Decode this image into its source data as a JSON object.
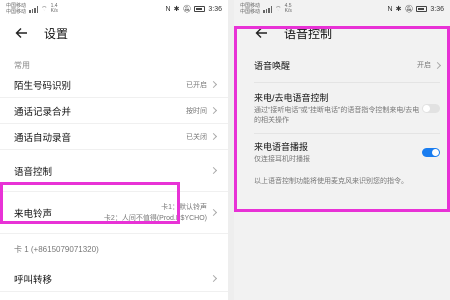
{
  "left": {
    "status": {
      "carrier1": "中国移动",
      "carrier2": "中国移动",
      "speed": "1.4",
      "speed_unit": "K/s",
      "time": "3:36",
      "battery": "",
      "nfc": "N",
      "bt": "✱"
    },
    "title": "设置",
    "section_label": "常用",
    "items": [
      {
        "label": "陌生号码识别",
        "value": "已开启"
      },
      {
        "label": "通话记录合并",
        "value": "按时间"
      },
      {
        "label": "通话自动录音",
        "value": "已关闭"
      },
      {
        "label": "语音控制",
        "value": ""
      }
    ],
    "ringtone": {
      "label": "来电铃声",
      "sim1": "卡1：默认铃声",
      "sim2": "卡2：人间不值得(Prod.P$YCHO)"
    },
    "sim_label": "卡 1 (+8615079071320)",
    "partial_item": "呼叫转移"
  },
  "right": {
    "status": {
      "carrier1": "中国移动",
      "carrier2": "中国移动",
      "speed": "4.5",
      "speed_unit": "K/s",
      "time": "3:36",
      "nfc": "N",
      "bt": "✱"
    },
    "title": "语音控制",
    "wake": {
      "label": "语音唤醒",
      "value": "开启"
    },
    "call_control": {
      "label": "来电/去电语音控制",
      "desc": "通过“接听电话”或“挂断电话”的语音指令控制来电/去电的相关操作"
    },
    "broadcast": {
      "label": "来电语音播报",
      "desc": "仅连接耳机时播报"
    },
    "note": "以上语音控制功能将使用麦克风来识别您的指令。"
  },
  "colors": {
    "highlight": "#e832d6",
    "toggle_on": "#1a7df0"
  }
}
